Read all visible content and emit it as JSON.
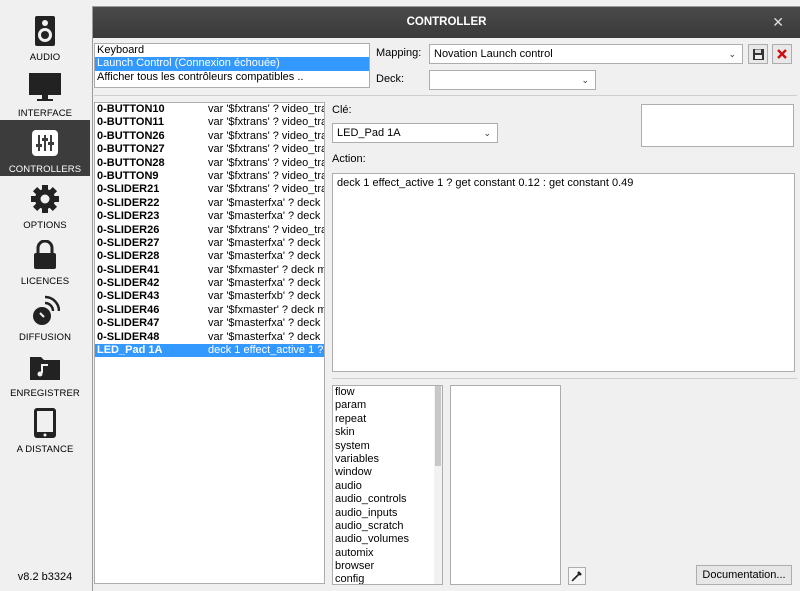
{
  "sidebar": {
    "items": [
      {
        "label": "AUDIO",
        "icon": "speaker-icon"
      },
      {
        "label": "INTERFACE",
        "icon": "monitor-icon"
      },
      {
        "label": "CONTROLLERS",
        "icon": "sliders-icon"
      },
      {
        "label": "OPTIONS",
        "icon": "gear-icon"
      },
      {
        "label": "LICENCES",
        "icon": "lock-icon"
      },
      {
        "label": "DIFFUSION",
        "icon": "broadcast-icon"
      },
      {
        "label": "ENREGISTRER",
        "icon": "music-folder-icon"
      },
      {
        "label": "A DISTANCE",
        "icon": "tablet-icon"
      }
    ],
    "active_index": 2,
    "version": "v8.2 b3324"
  },
  "dialog": {
    "title": "CONTROLLER",
    "close": "✕"
  },
  "devices": [
    {
      "label": "Keyboard",
      "selected": false
    },
    {
      "label": "Launch Control (Connexion échouée)",
      "selected": true
    },
    {
      "label": "Afficher tous les contrôleurs compatibles ..",
      "selected": false
    }
  ],
  "mapping": {
    "label": "Mapping:",
    "value": "Novation Launch control"
  },
  "deck": {
    "label": "Deck:",
    "value": ""
  },
  "mappings": [
    {
      "key": "0-BUTTON10",
      "action": "var '$fxtrans' ? video_tra"
    },
    {
      "key": "0-BUTTON11",
      "action": "var '$fxtrans' ? video_tra"
    },
    {
      "key": "0-BUTTON26",
      "action": "var '$fxtrans' ? video_tra"
    },
    {
      "key": "0-BUTTON27",
      "action": "var '$fxtrans' ? video_tra"
    },
    {
      "key": "0-BUTTON28",
      "action": "var '$fxtrans' ? video_tra"
    },
    {
      "key": "0-BUTTON9",
      "action": "var '$fxtrans' ? video_tra"
    },
    {
      "key": "0-SLIDER21",
      "action": "var '$fxtrans' ? video_tra"
    },
    {
      "key": "0-SLIDER22",
      "action": "var '$masterfxa' ? deck"
    },
    {
      "key": "0-SLIDER23",
      "action": "var '$masterfxa' ? deck"
    },
    {
      "key": "0-SLIDER26",
      "action": "var '$fxtrans' ? video_tra"
    },
    {
      "key": "0-SLIDER27",
      "action": "var '$masterfxa' ? deck"
    },
    {
      "key": "0-SLIDER28",
      "action": "var '$masterfxa' ? deck"
    },
    {
      "key": "0-SLIDER41",
      "action": "var '$fxmaster' ? deck m"
    },
    {
      "key": "0-SLIDER42",
      "action": "var '$masterfxa' ? deck"
    },
    {
      "key": "0-SLIDER43",
      "action": "var '$masterfxb' ? deck"
    },
    {
      "key": "0-SLIDER46",
      "action": "var '$fxmaster' ? deck m"
    },
    {
      "key": "0-SLIDER47",
      "action": "var '$masterfxa' ? deck"
    },
    {
      "key": "0-SLIDER48",
      "action": "var '$masterfxa' ? deck"
    },
    {
      "key": "LED_Pad 1A",
      "action": "deck 1 effect_active 1 ?"
    }
  ],
  "selected_mapping_index": 18,
  "key": {
    "label": "Clé:",
    "value": "LED_Pad 1A"
  },
  "action": {
    "label": "Action:",
    "value": "deck 1 effect_active 1 ? get constant 0.12 : get constant 0.49"
  },
  "categories": [
    "flow",
    "param",
    "repeat",
    "skin",
    "system",
    "variables",
    "window",
    "audio",
    "audio_controls",
    "audio_inputs",
    "audio_scratch",
    "audio_volumes",
    "automix",
    "browser",
    "config"
  ],
  "buttons": {
    "documentation": "Documentation..."
  }
}
